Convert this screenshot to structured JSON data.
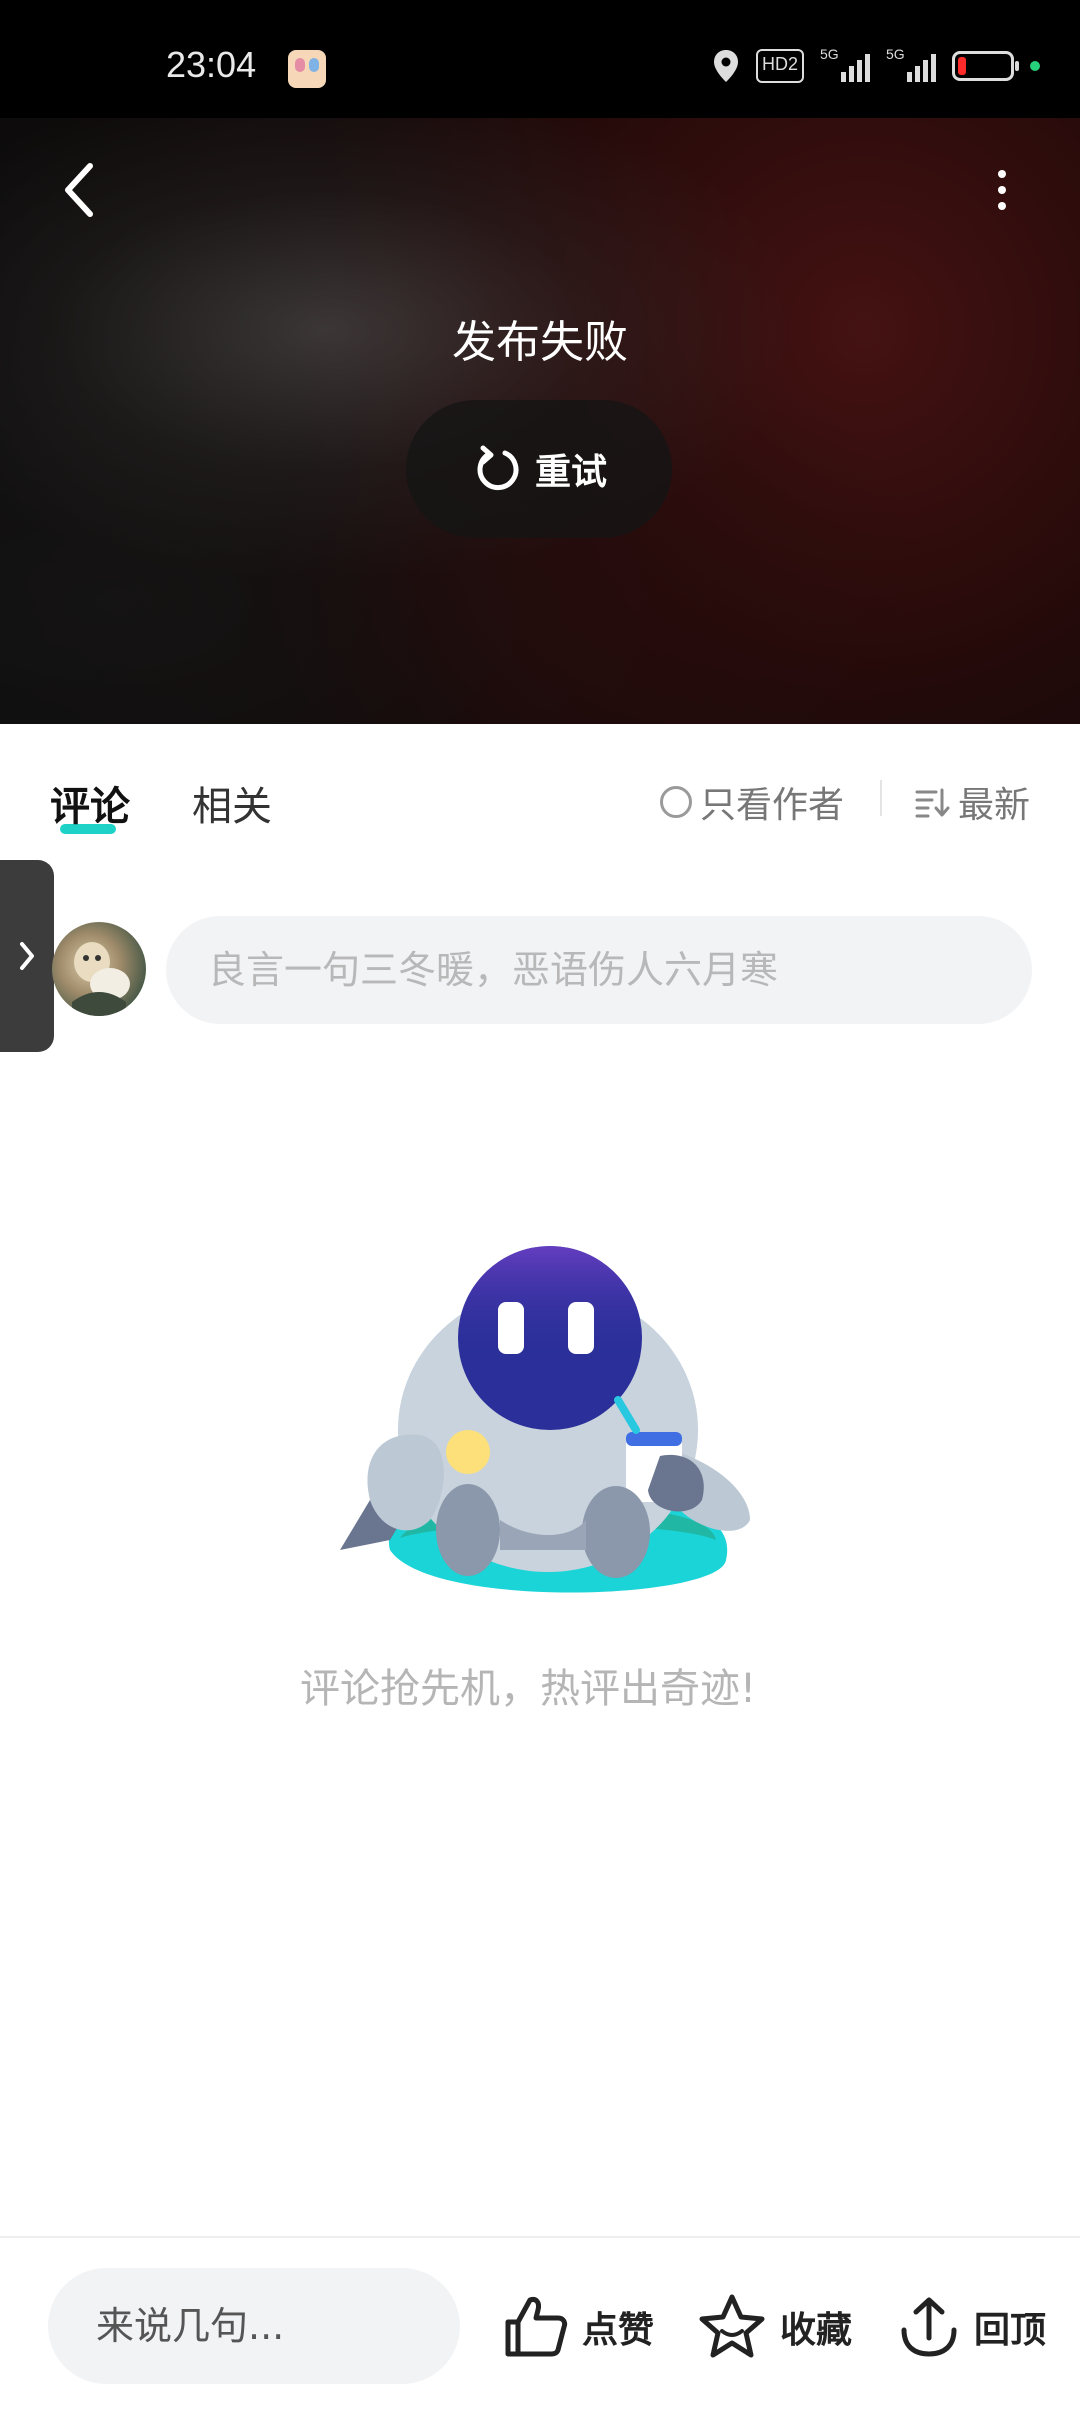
{
  "status_bar": {
    "time": "23:04",
    "hd_label": "HD2",
    "signal1_label": "5G",
    "signal2_label": "5G",
    "battery_level": 0.15,
    "battery_color": "#ff2b2b"
  },
  "video": {
    "fail_text": "发布失败",
    "retry_label": "重试"
  },
  "tabs": {
    "comments": "评论",
    "related": "相关",
    "author_only": "只看作者",
    "sort": "最新"
  },
  "comment_input": {
    "placeholder": "良言一句三冬暖，恶语伤人六月寒"
  },
  "empty_state": {
    "text": "评论抢先机，热评出奇迹!"
  },
  "bottom_bar": {
    "input_placeholder": "来说几句...",
    "like_label": "点赞",
    "favorite_label": "收藏",
    "top_label": "回顶"
  },
  "colors": {
    "accent": "#1fd2c8",
    "robot_face": "#2b2f9a",
    "robot_body": "#c8d3dd"
  }
}
